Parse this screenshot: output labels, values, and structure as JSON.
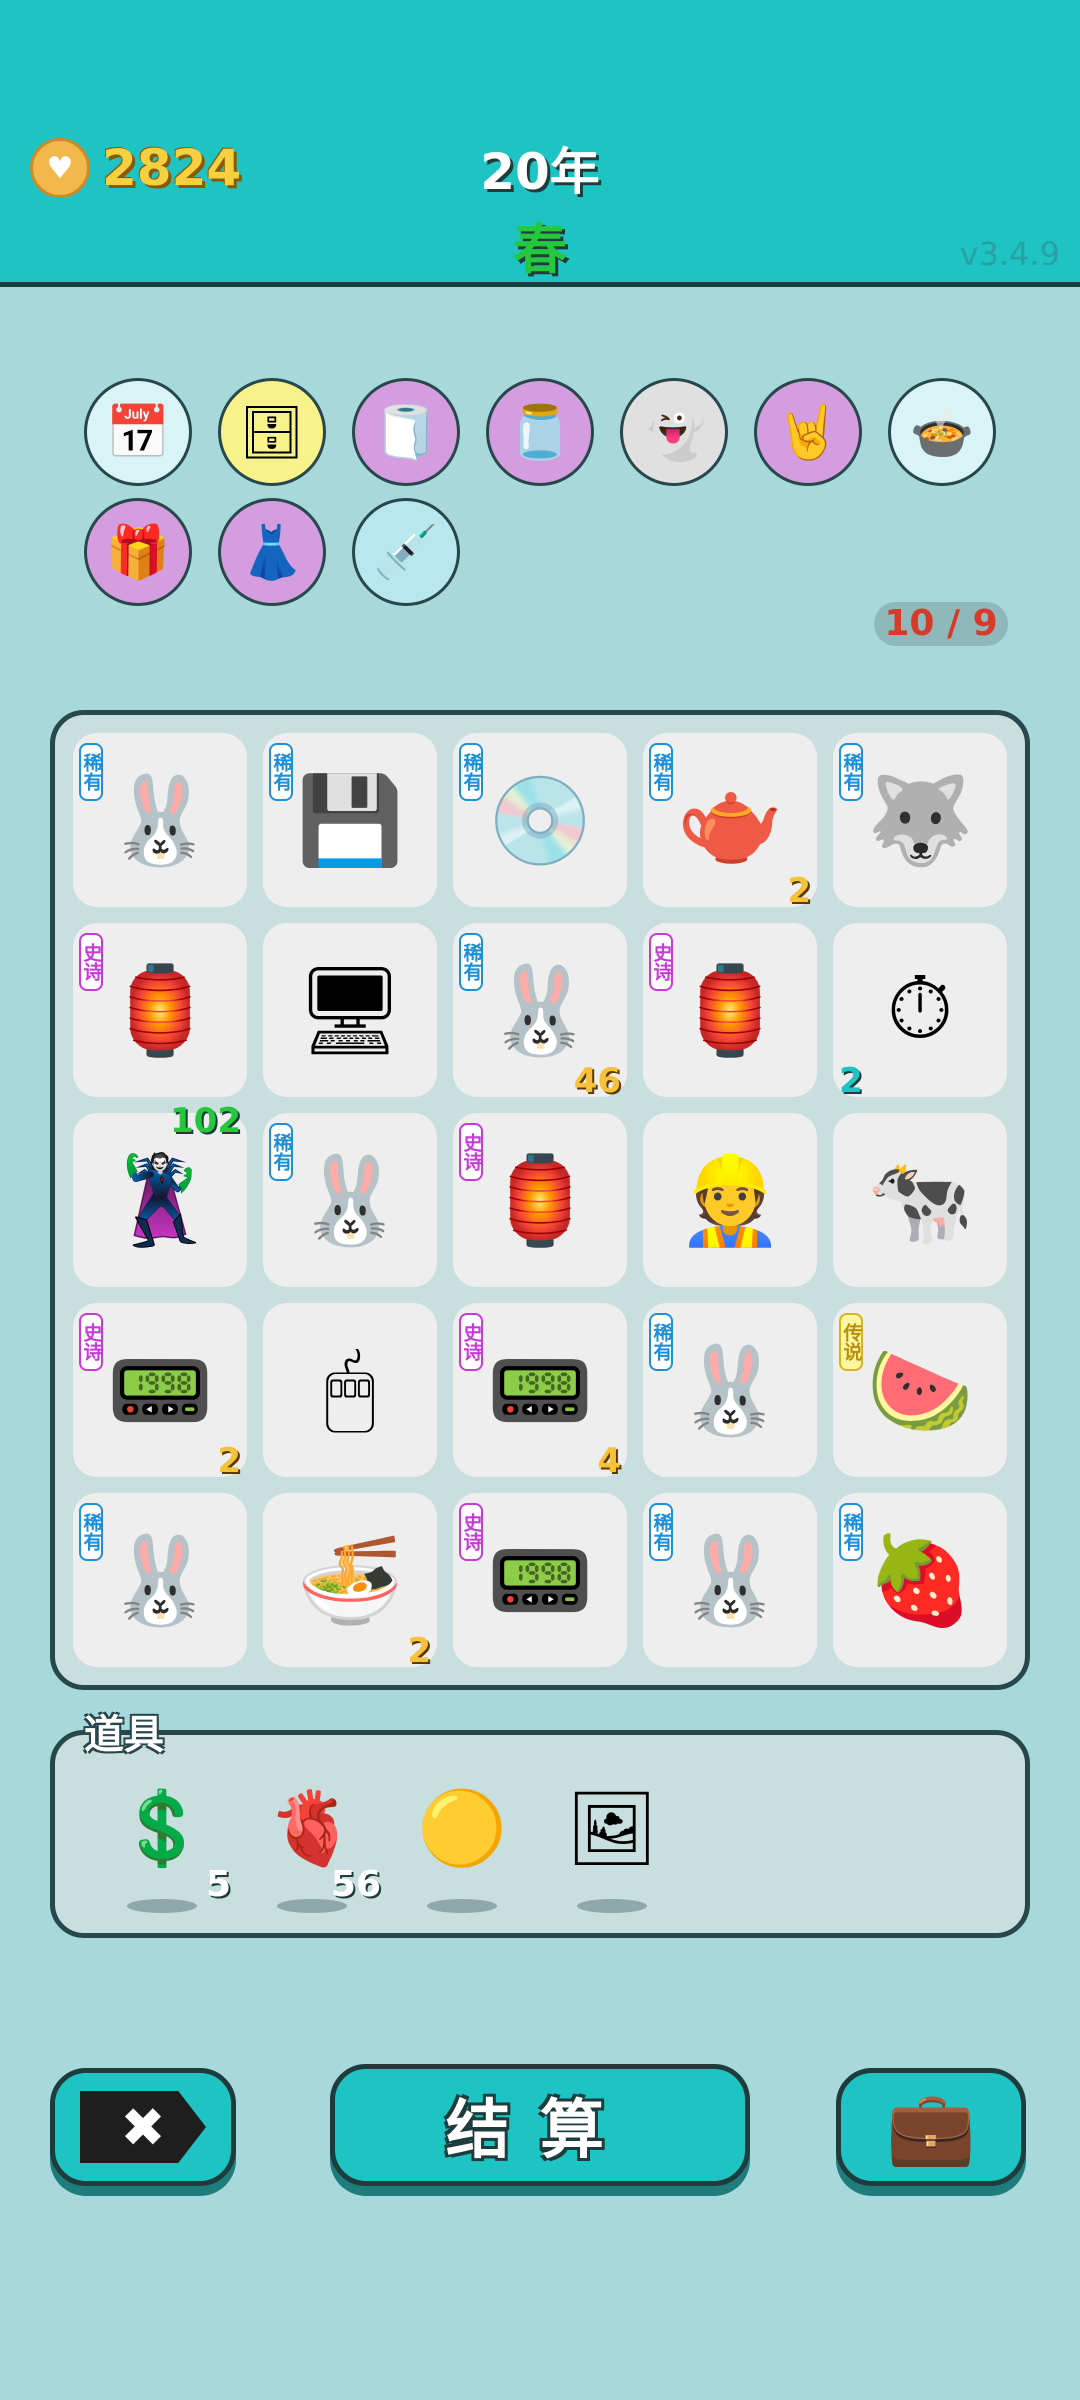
{
  "header": {
    "coins": "2824",
    "year": "20年",
    "season": "春",
    "version": "v3.4.9"
  },
  "buffs": [
    {
      "icon": "calendar-icon",
      "glyph": "📅",
      "bg": "#d9f4f6"
    },
    {
      "icon": "safe-icon",
      "glyph": "🗄",
      "bg": "#f8f28a"
    },
    {
      "icon": "tissue-box-icon",
      "glyph": "🧻",
      "bg": "#d49de0"
    },
    {
      "icon": "jar-icon",
      "glyph": "🫙",
      "bg": "#d49de0"
    },
    {
      "icon": "ghost-icon",
      "glyph": "👻",
      "bg": "#e0e0e0"
    },
    {
      "icon": "rock-hand-icon",
      "glyph": "🤘",
      "bg": "#d49de0"
    },
    {
      "icon": "duck-pot-icon",
      "glyph": "🍲",
      "bg": "#d9f4f6"
    },
    {
      "icon": "gift-box-icon",
      "glyph": "🎁",
      "bg": "#d49de0"
    },
    {
      "icon": "skirt-icon",
      "glyph": "👗",
      "bg": "#d49de0"
    },
    {
      "icon": "injection-creature-icon",
      "glyph": "💉",
      "bg": "#b8e8ee"
    }
  ],
  "counter": "10 / 9",
  "board": [
    {
      "icon": "rabbit-icon",
      "glyph": "🐰",
      "tag": "稀有",
      "tagType": "rare",
      "count": ""
    },
    {
      "icon": "cpu-chip-icon",
      "glyph": "💾",
      "tag": "稀有",
      "tagType": "rare",
      "count": ""
    },
    {
      "icon": "disc-icon",
      "glyph": "💿",
      "tag": "稀有",
      "tagType": "rare",
      "count": ""
    },
    {
      "icon": "teapot-icon",
      "glyph": "🫖",
      "tag": "稀有",
      "tagType": "rare",
      "count": "2"
    },
    {
      "icon": "husky-icon",
      "glyph": "🐺",
      "tag": "稀有",
      "tagType": "rare",
      "count": ""
    },
    {
      "icon": "rabbit-house-icon",
      "glyph": "🏮",
      "tag": "史诗",
      "tagType": "epic",
      "count": ""
    },
    {
      "icon": "computer-icon",
      "glyph": "🖥",
      "tag": "",
      "tagType": "",
      "count": ""
    },
    {
      "icon": "rabbit-star-icon",
      "glyph": "🐰",
      "tag": "稀有",
      "tagType": "rare",
      "count": "46"
    },
    {
      "icon": "rabbit-house-icon",
      "glyph": "🏮",
      "tag": "史诗",
      "tagType": "epic",
      "count": ""
    },
    {
      "icon": "stopwatch-card-icon",
      "glyph": "⏱",
      "tag": "",
      "tagType": "",
      "count": "2",
      "countPos": "left"
    },
    {
      "icon": "thief-icon",
      "glyph": "🦹",
      "tag": "",
      "tagType": "",
      "count": "102",
      "countPos": "top"
    },
    {
      "icon": "rabbit-icon",
      "glyph": "🐰",
      "tag": "稀有",
      "tagType": "rare",
      "count": ""
    },
    {
      "icon": "rabbit-house-icon",
      "glyph": "🏮",
      "tag": "史诗",
      "tagType": "epic",
      "count": ""
    },
    {
      "icon": "masked-man-icon",
      "glyph": "👷",
      "tag": "",
      "tagType": "",
      "count": ""
    },
    {
      "icon": "cow-icon",
      "glyph": "🐄",
      "tag": "",
      "tagType": "",
      "count": ""
    },
    {
      "icon": "graphics-card-icon",
      "glyph": "📟",
      "tag": "史诗",
      "tagType": "epic",
      "count": "2"
    },
    {
      "icon": "mouse-icon",
      "glyph": "🖱",
      "tag": "",
      "tagType": "",
      "count": ""
    },
    {
      "icon": "graphics-card-icon",
      "glyph": "📟",
      "tag": "史诗",
      "tagType": "epic",
      "count": "4"
    },
    {
      "icon": "rabbit-icon",
      "glyph": "🐰",
      "tag": "稀有",
      "tagType": "rare",
      "count": ""
    },
    {
      "icon": "watermelon-icon",
      "glyph": "🍉",
      "tag": "传说",
      "tagType": "legend",
      "count": ""
    },
    {
      "icon": "rabbit-icon",
      "glyph": "🐰",
      "tag": "稀有",
      "tagType": "rare",
      "count": ""
    },
    {
      "icon": "soup-bowl-icon",
      "glyph": "🍜",
      "tag": "",
      "tagType": "",
      "count": "2"
    },
    {
      "icon": "graphics-card-icon",
      "glyph": "📟",
      "tag": "史诗",
      "tagType": "epic",
      "count": ""
    },
    {
      "icon": "rabbit-icon",
      "glyph": "🐰",
      "tag": "稀有",
      "tagType": "rare",
      "count": ""
    },
    {
      "icon": "lychee-icon",
      "glyph": "🍓",
      "tag": "稀有",
      "tagType": "rare",
      "count": ""
    }
  ],
  "props": {
    "title": "道具",
    "items": [
      {
        "icon": "dollar-coin-icon",
        "glyph": "💲",
        "count": "5"
      },
      {
        "icon": "liver-icon",
        "glyph": "🫀",
        "count": "56"
      },
      {
        "icon": "golden-ball-icon",
        "glyph": "🟡",
        "count": ""
      },
      {
        "icon": "frame-icon",
        "glyph": "🖼",
        "count": ""
      }
    ]
  },
  "buttons": {
    "close_icon": "close-tag-icon",
    "close_glyph": "✖",
    "settle": "结算",
    "bag_icon": "briefcase-icon",
    "bag_glyph": "💼"
  }
}
